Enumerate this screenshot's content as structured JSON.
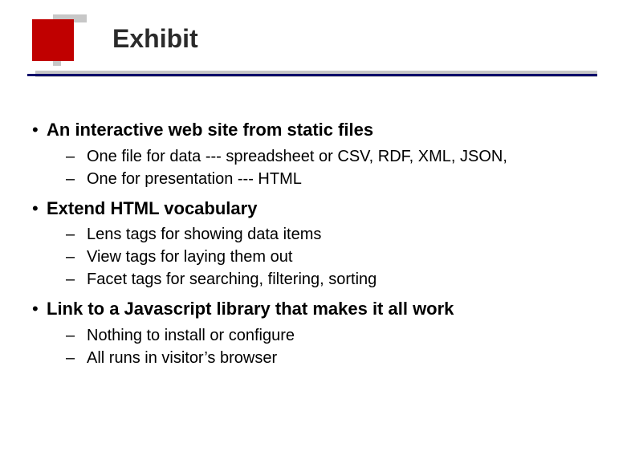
{
  "title": "Exhibit",
  "bullets": [
    {
      "text": "An interactive web site from static files",
      "sub": [
        "One file for data --- spreadsheet or CSV, RDF, XML, JSON,",
        "One for presentation --- HTML"
      ]
    },
    {
      "text": "Extend HTML vocabulary",
      "sub": [
        "Lens tags for showing data items",
        "View tags for laying them out",
        "Facet tags  for searching, filtering, sorting"
      ]
    },
    {
      "text": "Link to a Javascript library that makes it all work",
      "sub": [
        "Nothing to install or configure",
        "All runs in visitor’s browser"
      ]
    }
  ]
}
